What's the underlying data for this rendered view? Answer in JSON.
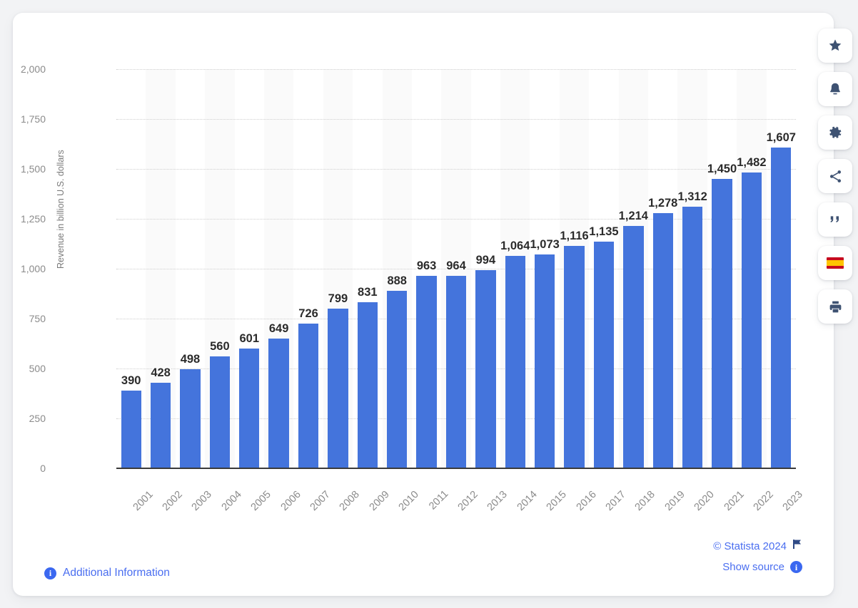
{
  "chart_data": {
    "type": "bar",
    "title": "",
    "xlabel": "",
    "ylabel": "Revenue in billion U.S. dollars",
    "ylim": [
      0,
      2000
    ],
    "ytick_values": [
      0,
      250,
      500,
      750,
      1000,
      1250,
      1500,
      1750,
      2000
    ],
    "ytick_labels": [
      "0",
      "250",
      "500",
      "750",
      "1,000",
      "1,250",
      "1,500",
      "1,750",
      "2,000"
    ],
    "grid": true,
    "legend": "none",
    "bar_color": "#4474dc",
    "categories": [
      "2001",
      "2002",
      "2003",
      "2004",
      "2005",
      "2006",
      "2007",
      "2008",
      "2009",
      "2010",
      "2011",
      "2012",
      "2013",
      "2014",
      "2015",
      "2016",
      "2017",
      "2018",
      "2019",
      "2020",
      "2021",
      "2022",
      "2023"
    ],
    "values": [
      390,
      428,
      498,
      560,
      601,
      649,
      726,
      799,
      831,
      888,
      963,
      964,
      994,
      1064,
      1073,
      1116,
      1135,
      1214,
      1278,
      1312,
      1450,
      1482,
      1607
    ],
    "value_labels": [
      "390",
      "428",
      "498",
      "560",
      "601",
      "649",
      "726",
      "799",
      "831",
      "888",
      "963",
      "964",
      "994",
      "1,064",
      "1,073",
      "1,116",
      "1,135",
      "1,214",
      "1,278",
      "1,312",
      "1,450",
      "1,482",
      "1,607"
    ]
  },
  "footer": {
    "additional_information": "Additional Information",
    "copyright": "© Statista 2024",
    "show_source": "Show source"
  },
  "rail": {
    "items": [
      {
        "icon": "star-icon",
        "label": "Add to favorites"
      },
      {
        "icon": "bell-icon",
        "label": "Notifications"
      },
      {
        "icon": "gear-icon",
        "label": "Settings"
      },
      {
        "icon": "share-icon",
        "label": "Share"
      },
      {
        "icon": "quote-icon",
        "label": "Citation"
      },
      {
        "icon": "spain-flag-icon",
        "label": "Spanish"
      },
      {
        "icon": "print-icon",
        "label": "Print"
      }
    ]
  },
  "colors": {
    "accent": "#4474dc",
    "link": "#4a6ef0",
    "page_background": "#f2f3f5",
    "card_background": "#ffffff",
    "axis": "#3a3a3a",
    "tick_text": "#8b8b8b"
  }
}
